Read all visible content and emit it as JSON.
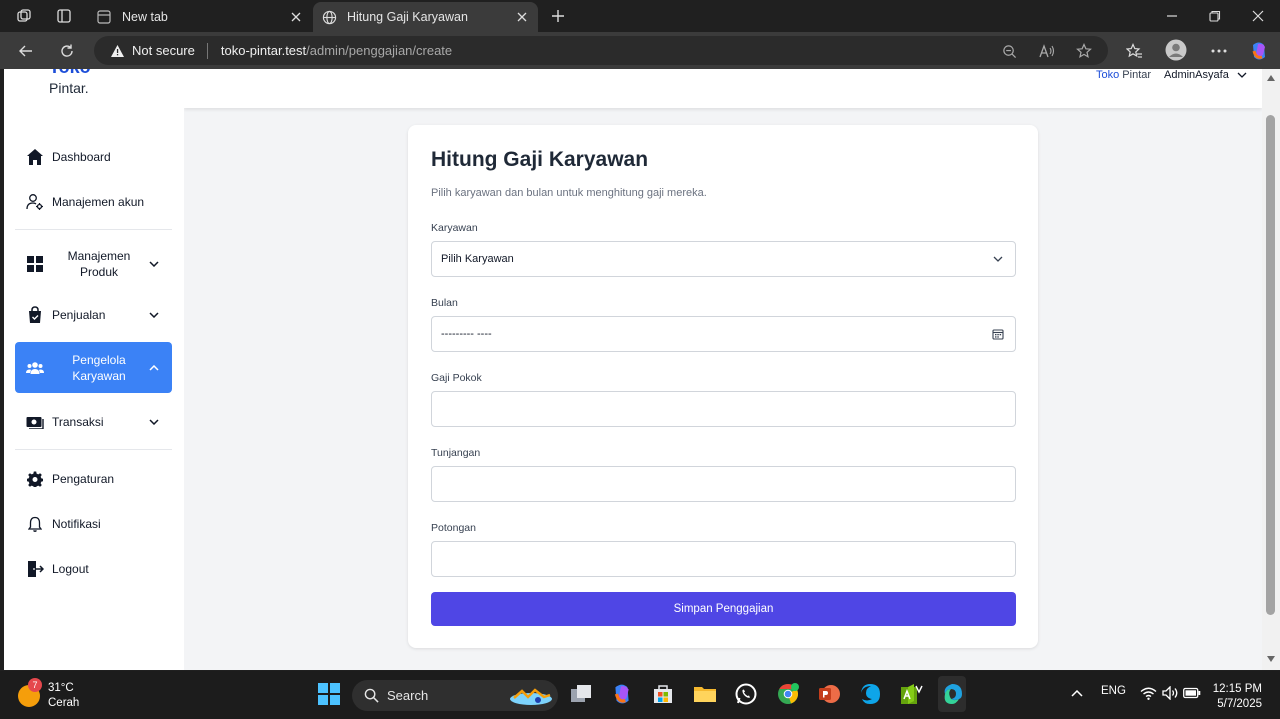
{
  "browser": {
    "tabs": [
      {
        "title": "New tab",
        "active": false
      },
      {
        "title": "Hitung Gaji Karyawan",
        "active": true
      }
    ],
    "address": {
      "security_label": "Not secure",
      "host": "toko-pintar.test",
      "path": "/admin/penggajian/create"
    }
  },
  "sidebar": {
    "brand_top": "Toko",
    "brand": "Pintar.",
    "items": [
      {
        "label": "Dashboard",
        "icon": "home-icon"
      },
      {
        "label": "Manajemen akun",
        "icon": "user-cog-icon"
      },
      {
        "label": "Manajemen Produk",
        "icon": "grid-icon"
      },
      {
        "label": "Penjualan",
        "icon": "shopping-bag-icon"
      },
      {
        "label": "Pengelola Karyawan",
        "icon": "users-icon"
      },
      {
        "label": "Transaksi",
        "icon": "money-icon"
      },
      {
        "label": "Pengaturan",
        "icon": "gear-icon"
      },
      {
        "label": "Notifikasi",
        "icon": "bell-icon"
      },
      {
        "label": "Logout",
        "icon": "logout-icon"
      }
    ]
  },
  "topbar": {
    "brand_blue": "Toko",
    "brand_rest": " Pintar",
    "user": "AdminAsyafa"
  },
  "form": {
    "title": "Hitung Gaji Karyawan",
    "subtitle": "Pilih karyawan dan bulan untuk menghitung gaji mereka.",
    "karyawan_label": "Karyawan",
    "karyawan_value": "Pilih Karyawan",
    "bulan_label": "Bulan",
    "bulan_value": "--------- ----",
    "gaji_label": "Gaji Pokok",
    "tunjangan_label": "Tunjangan",
    "potongan_label": "Potongan",
    "submit_label": "Simpan Penggajian"
  },
  "taskbar": {
    "weather_temp": "31°C",
    "weather_desc": "Cerah",
    "weather_badge": "7",
    "search_label": "Search",
    "lang": "ENG",
    "time": "12:15 PM",
    "date": "5/7/2025"
  },
  "colors": {
    "accent": "#3b82f6",
    "submit": "#4f46e5"
  }
}
